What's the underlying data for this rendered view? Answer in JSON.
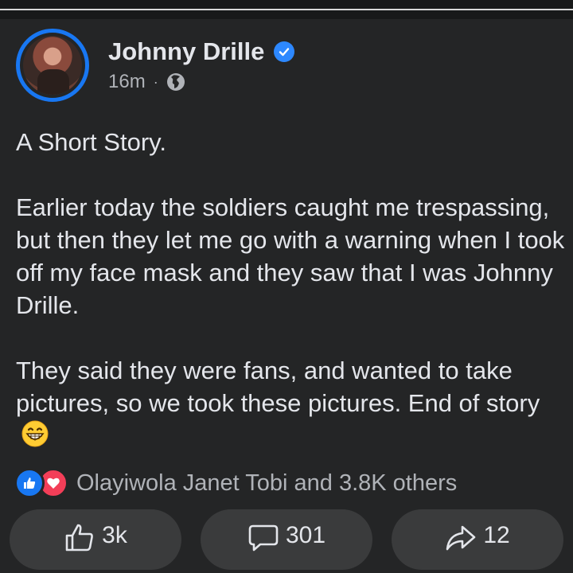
{
  "post": {
    "author": "Johnny Drille",
    "time": "16m",
    "separator": "·",
    "title": "A Short Story.",
    "paragraph1": "Earlier today the soldiers caught me trespassing, but then they let me go with a warning when I took off my face mask and they saw that I was Johnny Drille.",
    "paragraph2": "They said they were fans, and wanted to take pictures, so we took these pictures. End of story",
    "emoji": "grinning-face-emoji",
    "reactions_text": "Olayiwola Janet Tobi and 3.8K others",
    "likes": "3k",
    "comments": "301",
    "shares": "12"
  },
  "icons": {
    "verified": "verified-badge-icon",
    "privacy": "globe-icon",
    "like_reaction": "thumbs-up-icon",
    "love_reaction": "heart-icon",
    "like_action": "thumbs-up-outline-icon",
    "comment_action": "comment-bubble-icon",
    "share_action": "share-arrow-icon"
  },
  "colors": {
    "background": "#242526",
    "accent": "#1877f2",
    "love": "#f33e58",
    "pill": "#3a3b3c",
    "secondary_text": "#b0b3b8"
  }
}
